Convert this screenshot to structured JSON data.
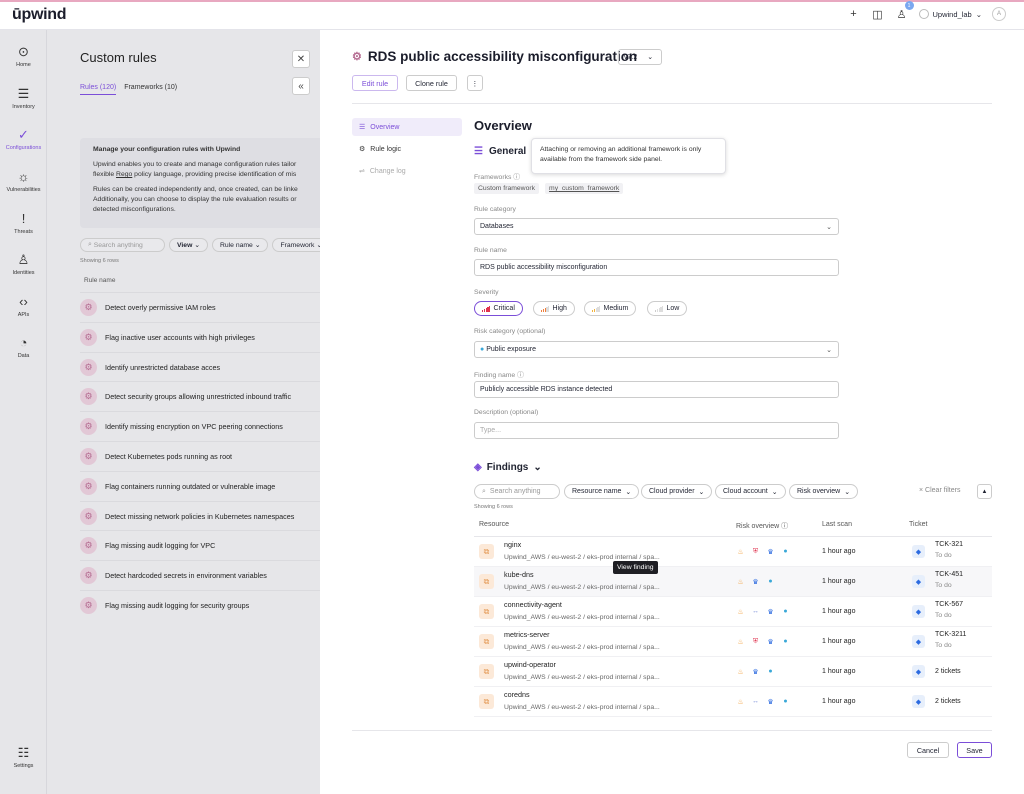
{
  "app": {
    "logo": "ūpwind",
    "notif_count": "1",
    "tenant": "Upwind_lab",
    "avatar": "A"
  },
  "nav": [
    {
      "label": "Home",
      "icon": "home-icon"
    },
    {
      "label": "Inventory",
      "icon": "inventory-icon"
    },
    {
      "label": "Configurations",
      "icon": "check-icon",
      "active": true
    },
    {
      "label": "Vulnerabilities",
      "icon": "bug-icon"
    },
    {
      "label": "Threats",
      "icon": "alert-icon"
    },
    {
      "label": "Identities",
      "icon": "person-icon"
    },
    {
      "label": "APIs",
      "icon": "code-icon"
    },
    {
      "label": "Data",
      "icon": "pie-icon"
    },
    {
      "label": "Settings",
      "icon": "sliders-icon"
    }
  ],
  "rules_panel": {
    "title": "Custom rules",
    "tabs": [
      "Rules (120)",
      "Frameworks (10)"
    ],
    "info_title": "Manage your configuration rules with Upwind",
    "info_p1": "Upwind enables you to create and manage configuration rules tailor",
    "info_p1b_pre": "flexible ",
    "info_p1b_link": "Rego",
    "info_p1b_post": " policy language, providing precise identification of mis",
    "info_p2": "Rules can be created independently and, once created, can be linke",
    "info_p2b": "Additionally, you can choose to display the rule evaluation results or",
    "info_p2c": "detected misconfigurations.",
    "search_placeholder": "Search anything",
    "filters": [
      "View",
      "Rule name",
      "Framework"
    ],
    "count": "Showing 6 rows",
    "column": "Rule name",
    "rules": [
      "Detect overly permissive IAM roles",
      "Flag inactive user accounts with high privileges",
      "Identify unrestricted database acces",
      "Detect security groups allowing unrestricted inbound traffic",
      "Identify missing encryption on VPC peering connections",
      "Detect Kubernetes pods running as root",
      "Flag containers running outdated or vulnerable image",
      "Detect missing network policies in Kubernetes namespaces",
      "Flag missing audit logging for VPC",
      "Detect hardcoded secrets in environment variables",
      "Flag missing audit logging for security groups"
    ]
  },
  "rule": {
    "title": "RDS public accessibility misconfiguration",
    "version": "v7.2",
    "edit_label": "Edit rule",
    "clone_label": "Clone rule",
    "more": "⋮",
    "subnav": [
      "Overview",
      "Rule logic",
      "Change log"
    ],
    "overview_heading": "Overview",
    "general_heading": "General",
    "tooltip": "Attaching or removing an additional framework is only available from the framework side panel.",
    "frameworks_label": "Frameworks",
    "frameworks": [
      "Custom framework",
      "my_custom_framework"
    ],
    "category_label": "Rule category",
    "category": "Databases",
    "name_label": "Rule name",
    "name": "RDS public accessibility misconfiguration",
    "severity_label": "Severity",
    "severities": [
      "Critical",
      "High",
      "Medium",
      "Low"
    ],
    "severity_selected": "Critical",
    "risk_label": "Risk category (optional)",
    "risk": "Public exposure",
    "finding_label": "Finding name",
    "finding": "Publicly accessible RDS instance detected",
    "desc_label": "Description (optional)",
    "desc_placeholder": "Type..."
  },
  "findings": {
    "heading": "Findings",
    "search_placeholder": "Search anything",
    "filters": [
      "Resource name",
      "Cloud provider",
      "Cloud account",
      "Risk overview"
    ],
    "clear": "Clear filters",
    "count": "Showing 6 rows",
    "columns": [
      "Resource",
      "Risk overview",
      "Last scan",
      "Ticket"
    ],
    "tooltip": "View finding",
    "rows": [
      {
        "name": "nginx",
        "path": "Upwind_AWS / eu-west-2 / eks-prod internal / spa...",
        "risks": [
          "fire",
          "shield",
          "crown",
          "globe"
        ],
        "scan": "1 hour ago",
        "ticket": "TCK-321",
        "status": "To do"
      },
      {
        "name": "kube-dns",
        "path": "Upwind_AWS / eu-west-2 / eks-prod internal / spa...",
        "risks": [
          "fire",
          "crown",
          "globe"
        ],
        "scan": "1 hour ago",
        "ticket": "TCK-451",
        "status": "To do"
      },
      {
        "name": "connectivity-agent",
        "path": "Upwind_AWS / eu-west-2 / eks-prod internal / spa...",
        "risks": [
          "fire",
          "link",
          "crown",
          "globe"
        ],
        "scan": "1 hour ago",
        "ticket": "TCK-567",
        "status": "To do"
      },
      {
        "name": "metrics-server",
        "path": "Upwind_AWS / eu-west-2 / eks-prod internal / spa...",
        "risks": [
          "fire",
          "shield",
          "crown",
          "globe"
        ],
        "scan": "1 hour ago",
        "ticket": "TCK-3211",
        "status": "To do"
      },
      {
        "name": "upwind-operator",
        "path": "Upwind_AWS / eu-west-2 / eks-prod internal / spa...",
        "risks": [
          "fire",
          "crown",
          "globe"
        ],
        "scan": "1 hour ago",
        "ticket": "2 tickets",
        "status": ""
      },
      {
        "name": "coredns",
        "path": "Upwind_AWS / eu-west-2 / eks-prod internal / spa...",
        "risks": [
          "fire",
          "link",
          "crown",
          "globe"
        ],
        "scan": "1 hour ago",
        "ticket": "2 tickets",
        "status": ""
      }
    ]
  },
  "footer": {
    "cancel": "Cancel",
    "save": "Save"
  },
  "colors": {
    "accent": "#7b4ed8",
    "critical": "#e0334f",
    "risk_fire": "#f2a03d",
    "risk_shield": "#e0334f",
    "risk_crown": "#2d6be0",
    "risk_globe": "#3aa8d8"
  }
}
